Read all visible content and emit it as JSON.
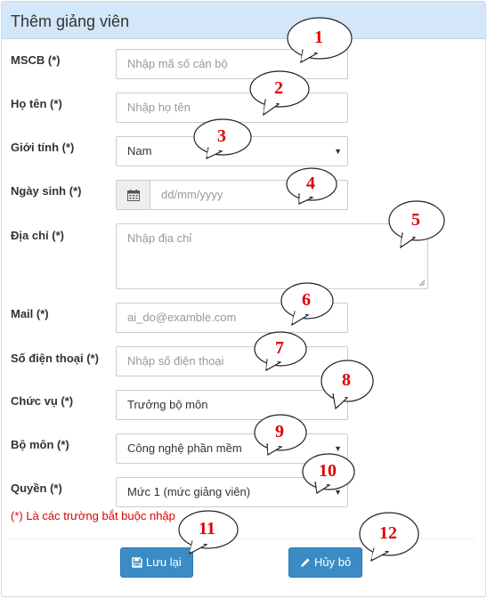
{
  "header": {
    "title": "Thêm giảng viên"
  },
  "form": {
    "mscb": {
      "label": "MSCB (*)",
      "placeholder": "Nhập mã số cán bộ"
    },
    "ho_ten": {
      "label": "Họ tên (*)",
      "placeholder": "Nhập họ tên"
    },
    "gioi_tinh": {
      "label": "Giới tính (*)",
      "value": "Nam"
    },
    "ngay_sinh": {
      "label": "Ngày sinh (*)",
      "placeholder": "dd/mm/yyyy",
      "icon": "calendar-icon"
    },
    "dia_chi": {
      "label": "Địa chỉ (*)",
      "placeholder": "Nhập địa chỉ"
    },
    "mail": {
      "label": "Mail (*)",
      "placeholder": "ai_do@examble.com"
    },
    "so_dien_thoai": {
      "label": "Số điện thoại (*)",
      "placeholder": "Nhập số điện thoại"
    },
    "chuc_vu": {
      "label": "Chức vụ (*)",
      "value": "Trưởng bộ môn"
    },
    "bo_mon": {
      "label": "Bộ môn (*)",
      "value": "Công nghệ phần mềm"
    },
    "quyen": {
      "label": "Quyền (*)",
      "value": "Mức 1 (mức giảng viên)"
    },
    "required_note": "(*) Là các trường bắt buộc nhập"
  },
  "buttons": {
    "save": {
      "label": "Lưu lại",
      "icon": "floppy-disk-icon"
    },
    "cancel": {
      "label": "Hủy bỏ",
      "icon": "pencil-icon"
    }
  },
  "callouts": [
    "1",
    "2",
    "3",
    "4",
    "5",
    "6",
    "7",
    "8",
    "9",
    "10",
    "11",
    "12"
  ],
  "colors": {
    "header_bg": "#d4e7f8",
    "button_bg": "#3b8cc4",
    "callout_number": "#e00000",
    "required_note": "#e00000"
  }
}
